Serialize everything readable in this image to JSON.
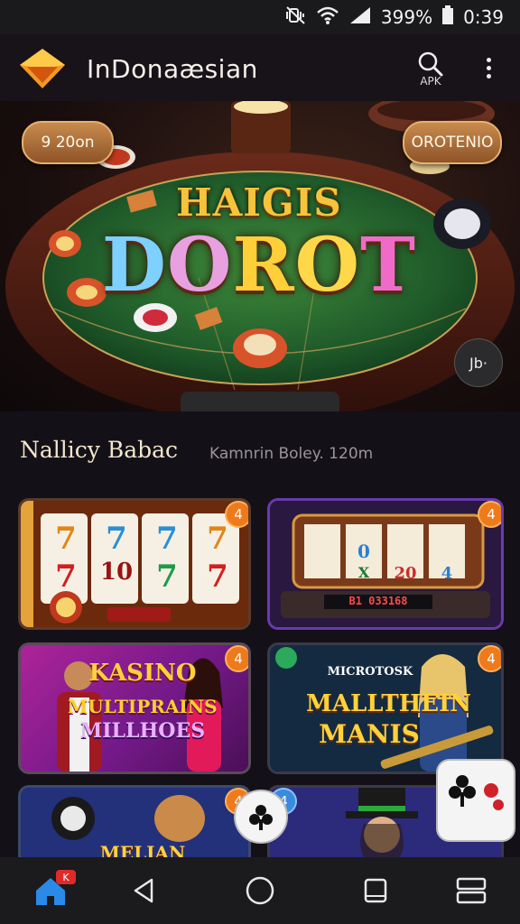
{
  "status_bar": {
    "battery_percent": "399%",
    "time": "0:39",
    "icons": [
      "mute-vibrate-icon",
      "wifi-icon",
      "signal-icon",
      "battery-icon"
    ]
  },
  "app_bar": {
    "title": "InDonaæsian",
    "search_label": "APK",
    "icons": [
      "brand-logo-icon",
      "search-icon",
      "more-vertical-icon"
    ]
  },
  "hero": {
    "left_pill": "9 20on",
    "right_pill": "OROTENIO",
    "title_top": "HAIGIS",
    "title_main": [
      "D",
      "O",
      "R",
      "O",
      "T"
    ],
    "corner_badge": "Jb·"
  },
  "section": {
    "title": "Nallicy Babac",
    "subtitle": "Kamnrin Boley. 120m"
  },
  "tiles": [
    {
      "badge": "4",
      "reels": [
        "7",
        "7",
        "7",
        "7",
        "7",
        "10",
        "7",
        "7"
      ]
    },
    {
      "badge": "4",
      "reels": [
        "0",
        "X",
        "20",
        "4"
      ],
      "counter": "B1 033168"
    },
    {
      "badge": "4",
      "line1": "KASINO",
      "line2": "MULTIPRAINS",
      "line3": "MILLHOES"
    },
    {
      "badge": "4",
      "line1": "MICROTOSK",
      "line2": "MALLTHEIN",
      "line3": "MANIS"
    },
    {
      "badge": "4",
      "line1": "MELIAN"
    },
    {
      "badge": "4"
    }
  ],
  "nav_bar": {
    "home_badge": "K",
    "icons": [
      "home-icon",
      "back-icon",
      "home-circle-icon",
      "recents-icon",
      "split-screen-icon"
    ]
  },
  "colors": {
    "accent_orange": "#ee7a1c",
    "table_green": "#1f5a2a",
    "gold": "#f6b42c",
    "background": "#141018"
  }
}
